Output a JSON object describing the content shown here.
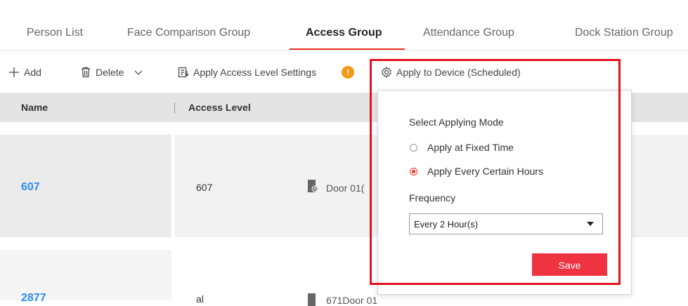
{
  "tabs": [
    {
      "label": "Person List"
    },
    {
      "label": "Face Comparison Group"
    },
    {
      "label": "Access Group"
    },
    {
      "label": "Attendance Group"
    },
    {
      "label": "Dock Station Group"
    }
  ],
  "toolbar": {
    "add_label": "Add",
    "delete_label": "Delete",
    "apply_access_label": "Apply Access Level Settings",
    "info_glyph": "!",
    "apply_device_label": "Apply to Device (Scheduled)"
  },
  "table": {
    "columns": [
      "Name",
      "Access Level"
    ],
    "rows": [
      {
        "name": "607",
        "access_level": "607",
        "door": "Door 01("
      },
      {
        "name": "2877",
        "access_level": "al",
        "door": "671Door 01"
      }
    ]
  },
  "popover": {
    "title": "Select Applying Mode",
    "options": [
      "Apply at Fixed Time",
      "Apply Every Certain Hours"
    ],
    "selected_option": "Apply Every Certain Hours",
    "frequency_label": "Frequency",
    "frequency_value": "Every 2 Hour(s)",
    "save_label": "Save"
  },
  "colors": {
    "accent": "#e32222",
    "link": "#2d8cf0",
    "info": "#f39b16",
    "save": "#ef3340",
    "highlight": "#e8101e"
  }
}
